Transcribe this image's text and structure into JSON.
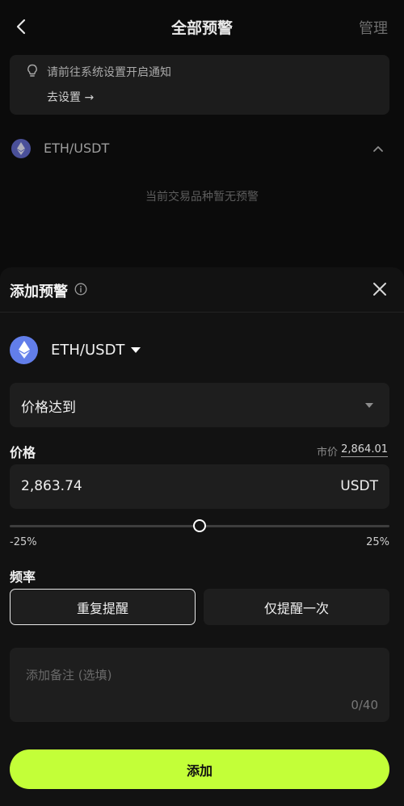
{
  "header": {
    "title": "全部预警",
    "manage_label": "管理"
  },
  "notice": {
    "text": "请前往系统设置开启通知",
    "link_label": "去设置 →"
  },
  "pair": {
    "name": "ETH/USDT",
    "empty_text": "当前交易品种暂无预警"
  },
  "sheet": {
    "title": "添加预警",
    "symbol": "ETH/USDT",
    "condition_value": "价格达到",
    "price_label": "价格",
    "market_label": "市价",
    "market_value": "2,864.01",
    "price_value": "2,863.74",
    "price_unit": "USDT",
    "slider": {
      "min_label": "-25%",
      "max_label": "25%",
      "value_fraction": 0.5
    },
    "frequency_label": "频率",
    "frequency_options": [
      "重复提醒",
      "仅提醒一次"
    ],
    "frequency_selected": "重复提醒",
    "note_placeholder": "添加备注 (选填)",
    "note_count": "0/40",
    "submit_label": "添加"
  },
  "colors": {
    "accent": "#c3ff38",
    "eth": "#627eea",
    "background": "#0b0b0b",
    "sheet": "#121212"
  },
  "icons": [
    "back-icon",
    "bulb-icon",
    "eth-icon",
    "chevron-up-icon",
    "info-icon",
    "close-icon",
    "caret-down-icon"
  ]
}
